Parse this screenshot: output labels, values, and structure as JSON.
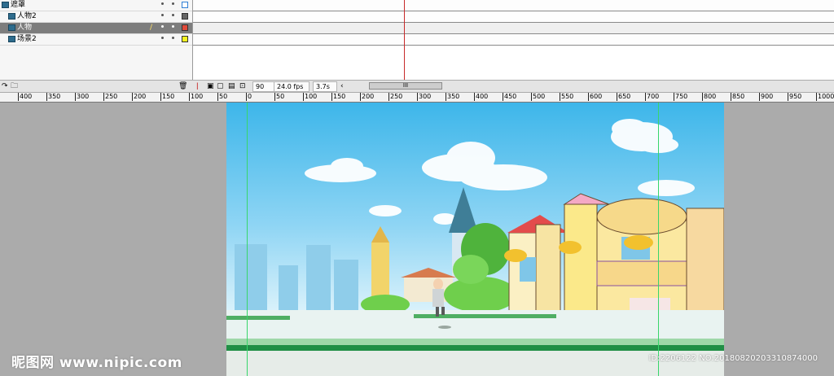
{
  "layers": [
    {
      "name": "遮罩",
      "type": "mask",
      "outline_color": "#2f7fd5",
      "selected": false
    },
    {
      "name": "人物2",
      "type": "masked",
      "outline_color": "#666666",
      "selected": false
    },
    {
      "name": "人物",
      "type": "masked",
      "outline_color": "#e04a3a",
      "selected": true
    },
    {
      "name": "场景2",
      "type": "masked",
      "outline_color": "#f2f220",
      "selected": false
    }
  ],
  "toolbar": {
    "frame": "90",
    "fps": "24.0 fps",
    "time": "3.7s",
    "scroll_grip": "III"
  },
  "ruler_ticks": [
    "400",
    "350",
    "300",
    "250",
    "200",
    "150",
    "100",
    "50",
    "0",
    "50",
    "100",
    "150",
    "200",
    "250",
    "300",
    "350",
    "400",
    "450",
    "500",
    "550",
    "600",
    "650",
    "700",
    "750",
    "800",
    "850",
    "900",
    "950",
    "1000"
  ],
  "watermark": {
    "left": "昵图网 www.nipic.com",
    "right": "ID:2206122 NO:20180820203310874000"
  },
  "colors": {
    "playhead": "#c72a2a",
    "guide": "#38d66b",
    "selected_layer": "#7d7d7d"
  }
}
